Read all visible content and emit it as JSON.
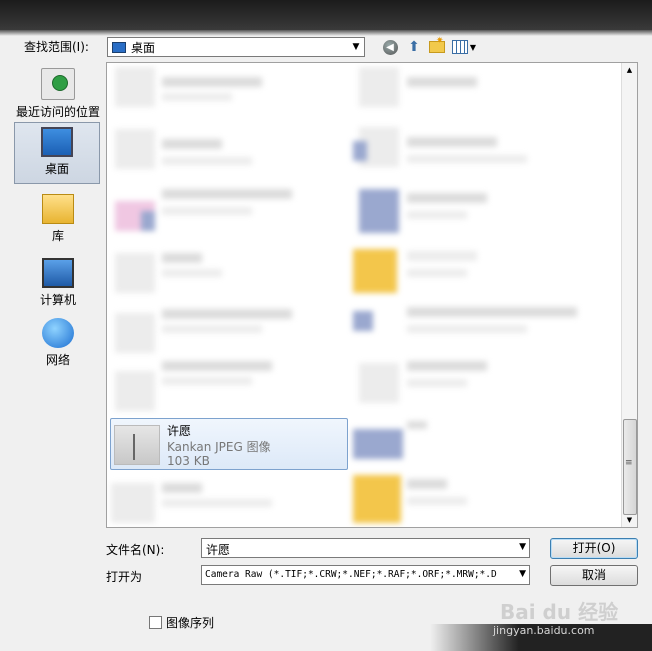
{
  "toolbar": {
    "look_in_label": "查找范围(I):",
    "look_in_value": "桌面"
  },
  "places": [
    {
      "label": "最近访问的位置"
    },
    {
      "label": "桌面"
    },
    {
      "label": "库"
    },
    {
      "label": "计算机"
    },
    {
      "label": "网络"
    }
  ],
  "selected_file": {
    "name": "许愿",
    "type": "Kankan JPEG 图像",
    "size": "103 KB"
  },
  "form": {
    "file_name_label": "文件名(N):",
    "file_name_value": "许愿",
    "file_type_label": "打开为",
    "file_type_value": "Camera Raw (*.TIF;*.CRW;*.NEF;*.RAF;*.ORF;*.MRW;*.D",
    "open_button": "打开(O)",
    "cancel_button": "取消",
    "sequence_checkbox": "图像序列"
  },
  "watermark": {
    "brand": "Bai du 经验",
    "url": "jingyan.baidu.com"
  }
}
